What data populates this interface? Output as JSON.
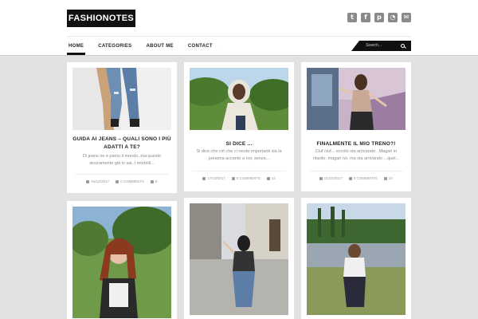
{
  "site": {
    "logo": "FASHIONOTES",
    "socials": [
      {
        "icon": "twitter-icon",
        "glyph": "t"
      },
      {
        "icon": "facebook-icon",
        "glyph": "f"
      },
      {
        "icon": "pinterest-icon",
        "glyph": "p"
      },
      {
        "icon": "rss-icon",
        "glyph": "◔"
      },
      {
        "icon": "mail-icon",
        "glyph": "✉"
      }
    ]
  },
  "nav": {
    "items": [
      "HOME",
      "CATEGORIES",
      "ABOUT ME",
      "CONTACT"
    ],
    "search_placeholder": "Search..."
  },
  "posts": [
    {
      "title": "GUIDA AI JEANS – QUALI SONO I PIÙ ADATTI A TE?",
      "excerpt": "Di jeans ne è pieno il mondo, ma questo sicuramente già lo sai. I modelli...",
      "date": "04/12/2017",
      "comments": "0 COMMENTS",
      "likes": "8"
    },
    {
      "title": "SI DICE ...",
      "excerpt": "Si dice che ciò che ci rende importanti sia la persona accanto a noi, senza...",
      "date": "17/10/2017",
      "comments": "0 COMMENTS",
      "likes": "12"
    },
    {
      "title": "FINALMENTE IL MIO TRENO?!",
      "excerpt": "Ciuf ciuf... eccolo sta arrivando . Magari in ritardo, magari no, ma sta arrivando ...quel...",
      "date": "01/10/2017",
      "comments": "0 COMMENTS",
      "likes": "10"
    },
    {
      "title": "",
      "excerpt": ""
    },
    {
      "title": "",
      "excerpt": ""
    },
    {
      "title": "",
      "excerpt": ""
    }
  ]
}
